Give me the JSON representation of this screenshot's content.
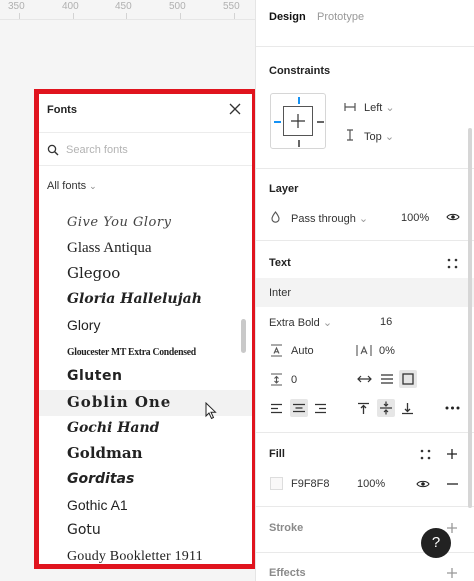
{
  "ruler": {
    "ticks": [
      "350",
      "400",
      "450",
      "500",
      "550"
    ]
  },
  "fonts_panel": {
    "title": "Fonts",
    "search_placeholder": "Search fonts",
    "filter_label": "All fonts",
    "items": [
      "Give You Glory",
      "Glass Antiqua",
      "Glegoo",
      "Gloria Hallelujah",
      "Glory",
      "Gloucester MT Extra Condensed",
      "Gluten",
      "Goblin One",
      "Gochi Hand",
      "Goldman",
      "Gorditas",
      "Gothic A1",
      "Gotu",
      "Goudy Bookletter 1911"
    ],
    "hovered_item": "Goblin One"
  },
  "tabs": {
    "design": "Design",
    "prototype": "Prototype"
  },
  "constraints": {
    "title": "Constraints",
    "horizontal": "Left",
    "vertical": "Top"
  },
  "layer": {
    "title": "Layer",
    "blend_mode": "Pass through",
    "opacity": "100%"
  },
  "text": {
    "title": "Text",
    "font_family": "Inter",
    "font_weight": "Extra Bold",
    "font_size": "16",
    "line_height": "Auto",
    "letter_spacing": "0%",
    "paragraph_spacing": "0"
  },
  "fill": {
    "title": "Fill",
    "hex": "F9F8F8",
    "opacity": "100%"
  },
  "stroke": {
    "title": "Stroke"
  },
  "effects": {
    "title": "Effects"
  },
  "help": {
    "label": "?"
  },
  "colors": {
    "highlight_border": "#e0141e",
    "hover_row": "#f2f2f2",
    "fill_swatch": "#F9F8F8"
  }
}
